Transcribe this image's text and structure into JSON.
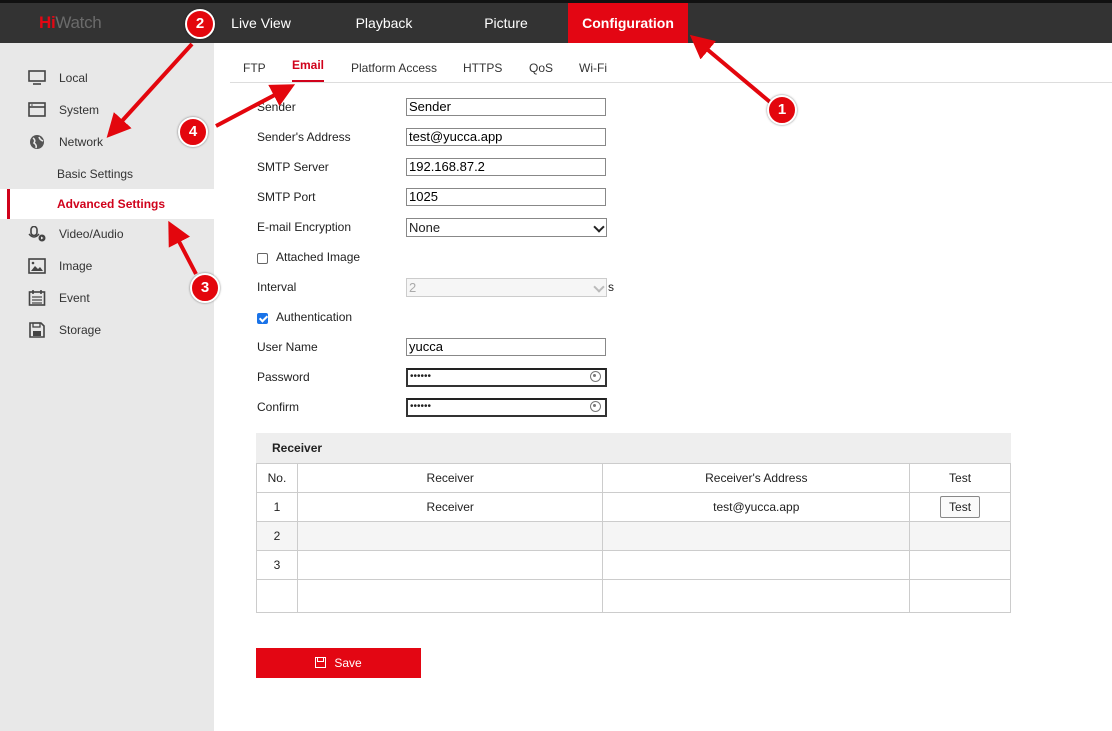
{
  "brand": {
    "prefix": "Hi",
    "rest": "Watch"
  },
  "topnav": [
    "Live View",
    "Playback",
    "Picture",
    "Configuration"
  ],
  "sidebar": {
    "items": [
      {
        "label": "Local",
        "icon": "monitor-icon"
      },
      {
        "label": "System",
        "icon": "system-icon"
      },
      {
        "label": "Network",
        "icon": "globe-icon"
      },
      {
        "label": "Video/Audio",
        "icon": "microphone-icon"
      },
      {
        "label": "Image",
        "icon": "image-icon"
      },
      {
        "label": "Event",
        "icon": "calendar-icon"
      },
      {
        "label": "Storage",
        "icon": "storage-icon"
      }
    ],
    "network_sub": [
      "Basic Settings",
      "Advanced Settings"
    ]
  },
  "tabs": [
    "FTP",
    "Email",
    "Platform Access",
    "HTTPS",
    "QoS",
    "Wi-Fi"
  ],
  "form": {
    "sender_label": "Sender",
    "sender_value": "Sender",
    "address_label": "Sender's Address",
    "address_value": "test@yucca.app",
    "smtp_label": "SMTP Server",
    "smtp_value": "192.168.87.2",
    "port_label": "SMTP Port",
    "port_value": "1025",
    "encryption_label": "E-mail Encryption",
    "encryption_value": "None",
    "attached_label": "Attached Image",
    "attached_checked": false,
    "interval_label": "Interval",
    "interval_value": "2",
    "interval_unit": "s",
    "auth_label": "Authentication",
    "auth_checked": true,
    "username_label": "User Name",
    "username_value": "yucca",
    "password_label": "Password",
    "password_value": "••••••",
    "confirm_label": "Confirm",
    "confirm_value": "••••••"
  },
  "receiver": {
    "title": "Receiver",
    "headers": [
      "No.",
      "Receiver",
      "Receiver's Address",
      "Test"
    ],
    "rows": [
      {
        "no": "1",
        "name": "Receiver",
        "address": "test@yucca.app",
        "test": "Test"
      },
      {
        "no": "2",
        "name": "",
        "address": "",
        "test": ""
      },
      {
        "no": "3",
        "name": "",
        "address": "",
        "test": ""
      },
      {
        "no": "",
        "name": "",
        "address": "",
        "test": ""
      }
    ]
  },
  "save_label": "Save",
  "annotations": [
    "1",
    "2",
    "3",
    "4"
  ],
  "colors": {
    "accent": "#e30613",
    "topbar": "#333333",
    "sidebar": "#e8e8e8"
  }
}
